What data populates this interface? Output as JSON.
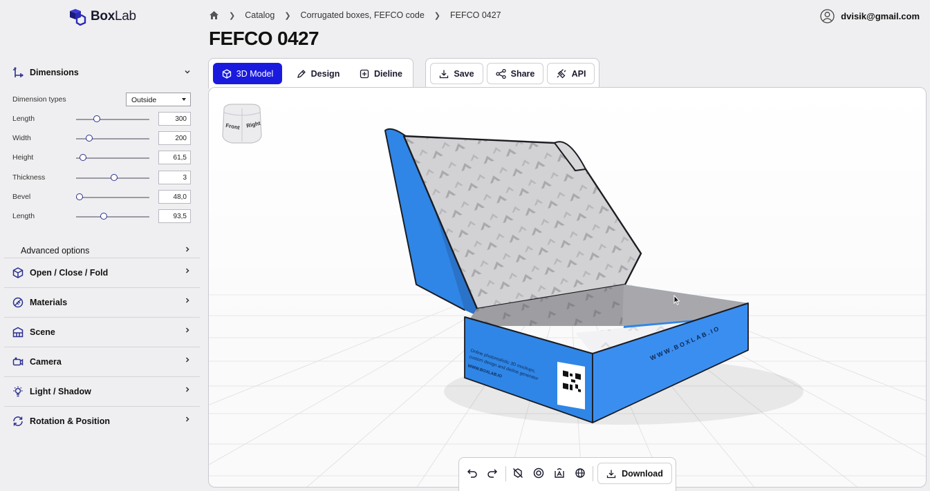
{
  "brand": {
    "name_bold": "Box",
    "name_light": "Lab"
  },
  "breadcrumb": [
    "Catalog",
    "Corrugated boxes, FEFCO code",
    "FEFCO 0427"
  ],
  "page_title": "FEFCO 0427",
  "user": {
    "email": "dvisik@gmail.com"
  },
  "tabs": [
    "3D Model",
    "Design",
    "Dieline"
  ],
  "actions": [
    "Save",
    "Share",
    "API"
  ],
  "sidebar": {
    "dimensions": {
      "title": "Dimensions",
      "dimension_types_label": "Dimension types",
      "dimension_types_value": "Outside",
      "params": [
        {
          "label": "Length",
          "value": "300",
          "level": 0.26
        },
        {
          "label": "Width",
          "value": "200",
          "level": 0.16
        },
        {
          "label": "Height",
          "value": "61,5",
          "level": 0.08
        },
        {
          "label": "Thickness",
          "value": "3",
          "level": 0.5
        },
        {
          "label": "Bevel",
          "value": "48,0",
          "level": 0.03
        },
        {
          "label": "Length",
          "value": "93,5",
          "level": 0.36
        }
      ],
      "advanced": "Advanced options"
    },
    "sections": [
      {
        "label": "Open / Close / Fold",
        "icon": "box-icon"
      },
      {
        "label": "Materials",
        "icon": "materials-icon"
      },
      {
        "label": "Scene",
        "icon": "scene-icon"
      },
      {
        "label": "Camera",
        "icon": "camera-icon"
      },
      {
        "label": "Light / Shadow",
        "icon": "light-icon"
      },
      {
        "label": "Rotation & Position",
        "icon": "rotation-icon"
      }
    ]
  },
  "nav_cube": {
    "front": "Front",
    "right": "Right"
  },
  "box_print": {
    "side_text": "WWW.BOXLAB.IO",
    "front_line1": "Online photorealistic 3D mockups,",
    "front_line2": "custom design and dieline generator",
    "front_url": "WWW.BOXLAB.IO"
  },
  "bottom_toolbar": {
    "download": "Download"
  },
  "colors": {
    "accent": "#1a1adf",
    "box_blue": "#2f86e6"
  }
}
